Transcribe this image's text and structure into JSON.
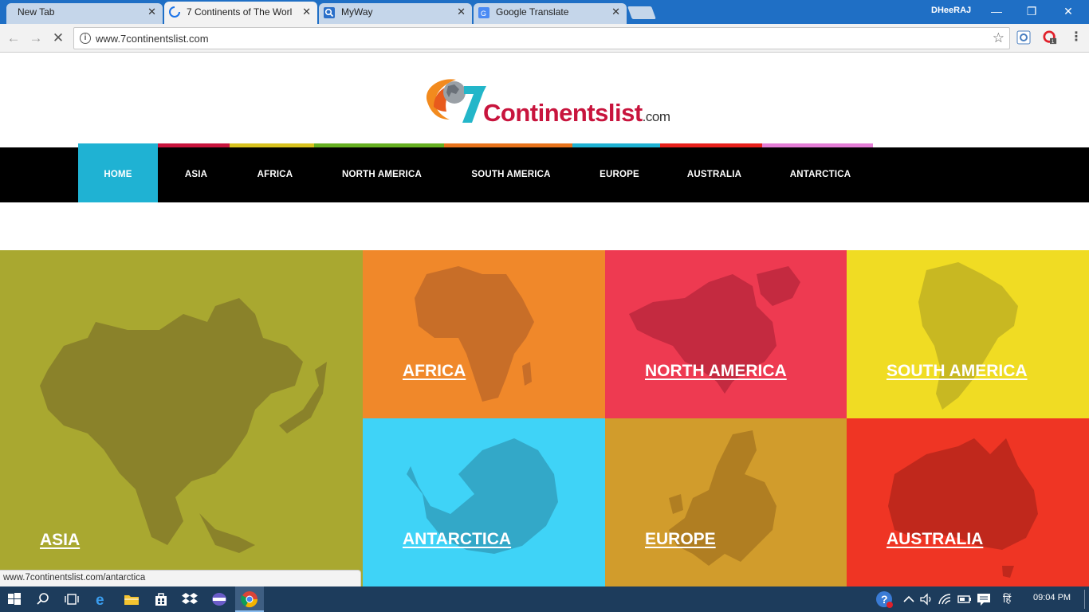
{
  "browser": {
    "tabs": [
      {
        "title": "New Tab",
        "active": false
      },
      {
        "title": "7 Continents of The Worl",
        "active": true
      },
      {
        "title": "MyWay",
        "active": false
      },
      {
        "title": "Google Translate",
        "active": false
      }
    ],
    "tab_close_glyph": "✕",
    "user_name": "DHeeRAJ",
    "url": "www.7continentslist.com",
    "status_url": "www.7continentslist.com/antarctica"
  },
  "site": {
    "logo": {
      "digit": "7",
      "word": "Continentslist",
      "suffix": ".com"
    },
    "strip_colors": [
      "#c8143d",
      "#d8c21f",
      "#66b022",
      "#e8731c",
      "#1fb2d3",
      "#e8201c",
      "#e47dd6"
    ],
    "nav": [
      "HOME",
      "ASIA",
      "AFRICA",
      "NORTH AMERICA",
      "SOUTH AMERICA",
      "EUROPE",
      "AUSTRALIA",
      "ANTARCTICA"
    ],
    "active_nav": "HOME",
    "tiles": [
      {
        "name": "ASIA",
        "color": "#a9a830",
        "map_color": "#8a822a"
      },
      {
        "name": "AFRICA",
        "color": "#f0882a",
        "map_color": "#c86e28"
      },
      {
        "name": "NORTH AMERICA",
        "color": "#ee3a51",
        "map_color": "#c42a40"
      },
      {
        "name": "SOUTH AMERICA",
        "color": "#f0dc23",
        "map_color": "#c8b822"
      },
      {
        "name": "ANTARCTICA",
        "color": "#3fd3f7",
        "map_color": "#33a8c8"
      },
      {
        "name": "EUROPE",
        "color": "#d19c2c",
        "map_color": "#b07e22"
      },
      {
        "name": "AUSTRALIA",
        "color": "#ef3524",
        "map_color": "#c0281c"
      }
    ]
  },
  "taskbar": {
    "time": "09:04 PM",
    "lang": "हिं"
  }
}
